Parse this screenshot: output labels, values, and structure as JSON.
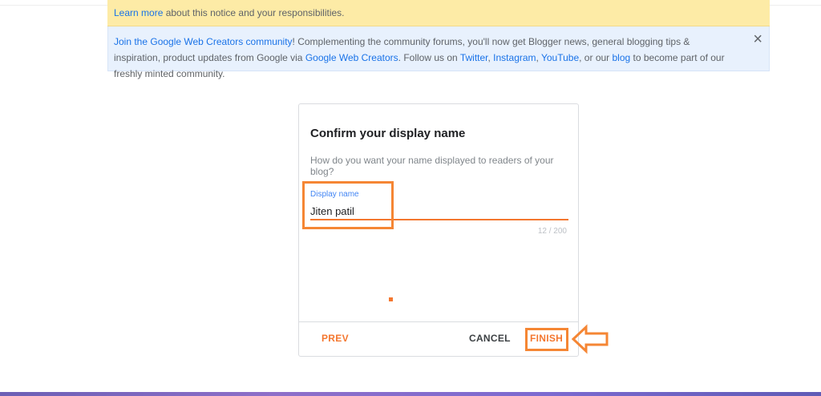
{
  "notice": {
    "learn_more_link": "Learn more",
    "text": " about this notice and your responsibilities."
  },
  "community": {
    "link_join": "Join the Google Web Creators community",
    "text1": "! Complementing the community forums, you'll now get Blogger news, general blogging tips & inspiration, product updates from Google via ",
    "link_creators": "Google Web Creators",
    "text2": ". Follow us on ",
    "link_twitter": "Twitter",
    "sep1": ", ",
    "link_instagram": "Instagram",
    "sep2": ", ",
    "link_youtube": "YouTube",
    "text3": ", or our ",
    "link_blog": "blog",
    "text4": " to become part of our freshly minted community.",
    "close_icon": "×"
  },
  "dialog": {
    "title": "Confirm your display name",
    "subtitle": "How do you want your name displayed to readers of your blog?",
    "field_label": "Display name",
    "field_value": "Jiten patil",
    "counter": "12 / 200",
    "prev_button": "PREV",
    "cancel_button": "CANCEL",
    "finish_button": "FINISH"
  },
  "colors": {
    "accent": "#f4772f",
    "annotation": "#f58634",
    "link": "#1a73e8",
    "notice_yellow": "#fdeba6",
    "notice_blue": "#e8f1fd"
  }
}
